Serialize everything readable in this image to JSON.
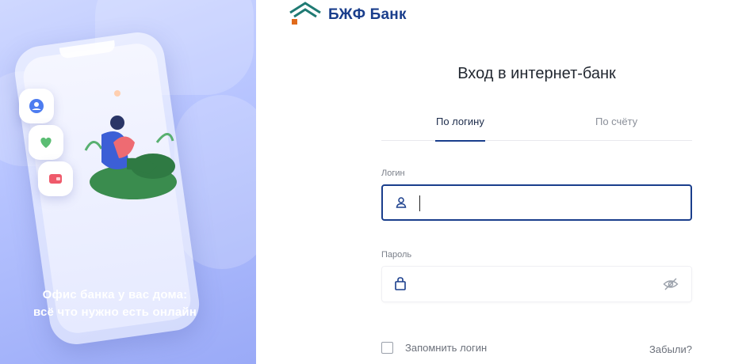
{
  "promo": {
    "line1": "Офис банка у вас дома:",
    "line2": "всё что нужно есть онлайн",
    "colors": {
      "panel": "#b7c4ff",
      "text": "#ffffff"
    }
  },
  "brand": {
    "name": "БЖФ Банк",
    "color": "#1a3e8c",
    "logo_colors": {
      "roof": "#1f7a73",
      "door": "#e06a1b"
    }
  },
  "login": {
    "title": "Вход в интернет-банк",
    "tabs": [
      {
        "label": "По логину",
        "active": true
      },
      {
        "label": "По счёту",
        "active": false
      }
    ],
    "login_field": {
      "label": "Логин",
      "value": "",
      "icon": "user-icon"
    },
    "password_field": {
      "label": "Пароль",
      "value": "",
      "icon": "lock-icon",
      "toggle_icon": "eye-hidden-icon"
    },
    "remember_label": "Запомнить логин",
    "remember_checked": false,
    "forgot_label": "Забыли?"
  }
}
